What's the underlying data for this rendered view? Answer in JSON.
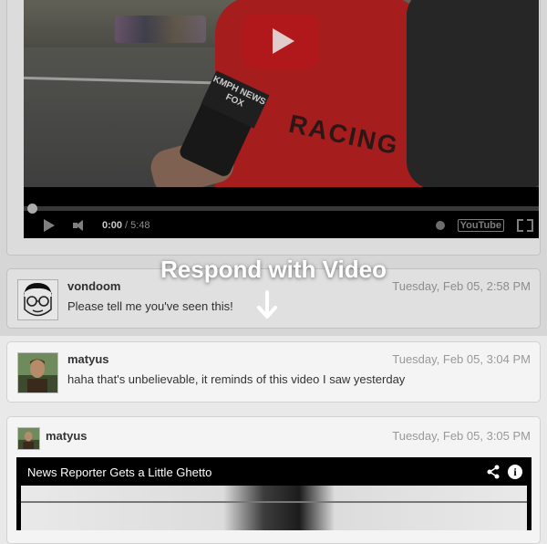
{
  "video1": {
    "current_time": "0:00",
    "duration": "/ 5:48",
    "scene": {
      "mic_flag_text": "KMPH NEWS FOX",
      "shirt_text": "RACING"
    },
    "youtube_logo_text": "YouTube"
  },
  "overlay": {
    "respond_label": "Respond with Video"
  },
  "messages": [
    {
      "user": "vondoom",
      "time": "Tuesday, Feb 05, 2:58 PM",
      "text": "Please tell me you've seen this!"
    },
    {
      "user": "matyus",
      "time": "Tuesday, Feb 05, 3:04 PM",
      "text": "haha that's unbelievable, it reminds of this video I saw yesterday"
    },
    {
      "user": "matyus",
      "time": "Tuesday, Feb 05, 3:05 PM",
      "video_title": "News Reporter Gets a Little Ghetto"
    }
  ],
  "colors": {
    "page_bg": "#e9e9e9",
    "card_bg": "#f4f4f4",
    "yt_red": "#cc181e"
  },
  "icons": {
    "play": "play-icon",
    "volume": "volume-icon",
    "fullscreen": "fullscreen-icon",
    "share": "share-icon",
    "info": "info-icon",
    "arrow": "arrow-down-icon"
  }
}
